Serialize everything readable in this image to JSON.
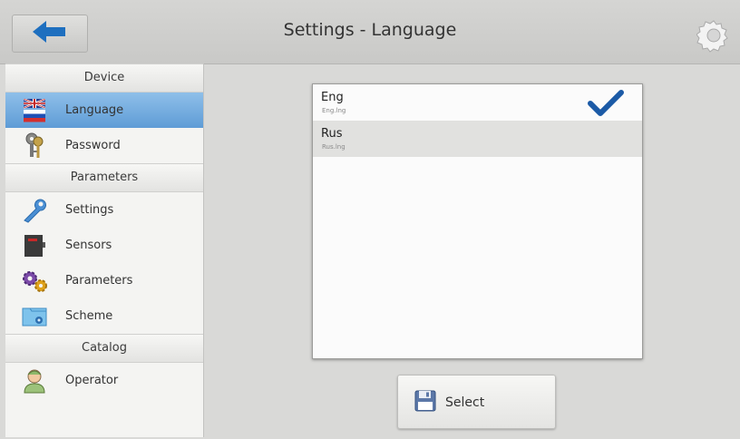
{
  "header": {
    "title": "Settings - Language"
  },
  "sidebar": {
    "sections": [
      {
        "label": "Device"
      },
      {
        "label": "Parameters"
      },
      {
        "label": "Catalog"
      }
    ],
    "items": [
      {
        "label": "Language",
        "icon": "flag-icon",
        "selected": true
      },
      {
        "label": "Password",
        "icon": "keys-icon"
      },
      {
        "label": "Settings",
        "icon": "wrench-icon"
      },
      {
        "label": "Sensors",
        "icon": "sensor-icon"
      },
      {
        "label": "Parameters",
        "icon": "gears-icon"
      },
      {
        "label": "Scheme",
        "icon": "scheme-icon"
      },
      {
        "label": "Operator",
        "icon": "operator-icon"
      }
    ]
  },
  "languages": [
    {
      "name": "Eng",
      "file": "Eng.lng",
      "checked": true
    },
    {
      "name": "Rus",
      "file": "Rus.lng",
      "highlighted": true
    }
  ],
  "actions": {
    "select_label": "Select"
  },
  "colors": {
    "accent": "#1e6fbf",
    "selection": "#7fb3e3",
    "check": "#1b5aa6"
  }
}
